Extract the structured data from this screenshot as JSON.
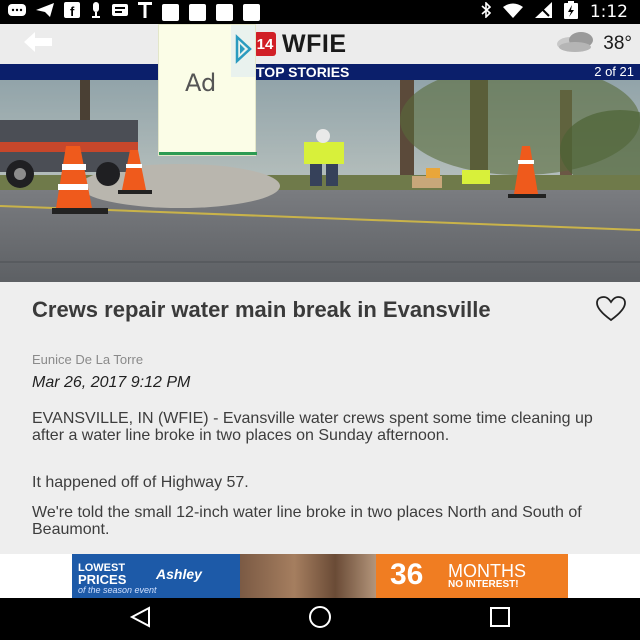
{
  "status_bar": {
    "time": "1:12",
    "icons": [
      "message-icon",
      "send-icon",
      "facebook-icon",
      "mic-icon",
      "news-icon",
      "text-icon",
      "notification-icon",
      "notification-icon",
      "notification-icon",
      "notification-icon",
      "bluetooth-icon",
      "wifi-icon",
      "no-signal-icon",
      "battery-icon"
    ]
  },
  "header": {
    "logo_mark": "14",
    "logo_text": "WFIE",
    "weather_temp": "38°",
    "weather_icon": "cloudy-icon"
  },
  "section": {
    "title": "TOP STORIES",
    "counter": "2 of 21"
  },
  "ad_overlay": {
    "label": "Ad"
  },
  "article": {
    "headline": "Crews repair water main break in Evansville",
    "author": "Eunice De La Torre",
    "date": "Mar 26, 2017 9:12 PM",
    "paragraphs": [
      "EVANSVILLE, IN (WFIE) - Evansville water crews spent some time cleaning up after a water line broke in two places on Sunday afternoon.",
      "It happened off of Highway 57.",
      "We're told the small 12-inch water line broke in two places North and South of Beaumont."
    ]
  },
  "banner_ad": {
    "line1": "LOWEST",
    "line2": "PRICES",
    "line3": "of the season event",
    "brand": "Ashley",
    "number": "36",
    "months": "MONTHS",
    "sub": "NO INTEREST!",
    "colors": {
      "left": "#1d5aa8",
      "right": "#f07d22"
    }
  },
  "colors": {
    "section_bar": "#0b1f6b",
    "header_bg": "#ececec",
    "article_bg": "#eeeeee",
    "brand_red": "#d11f26"
  }
}
